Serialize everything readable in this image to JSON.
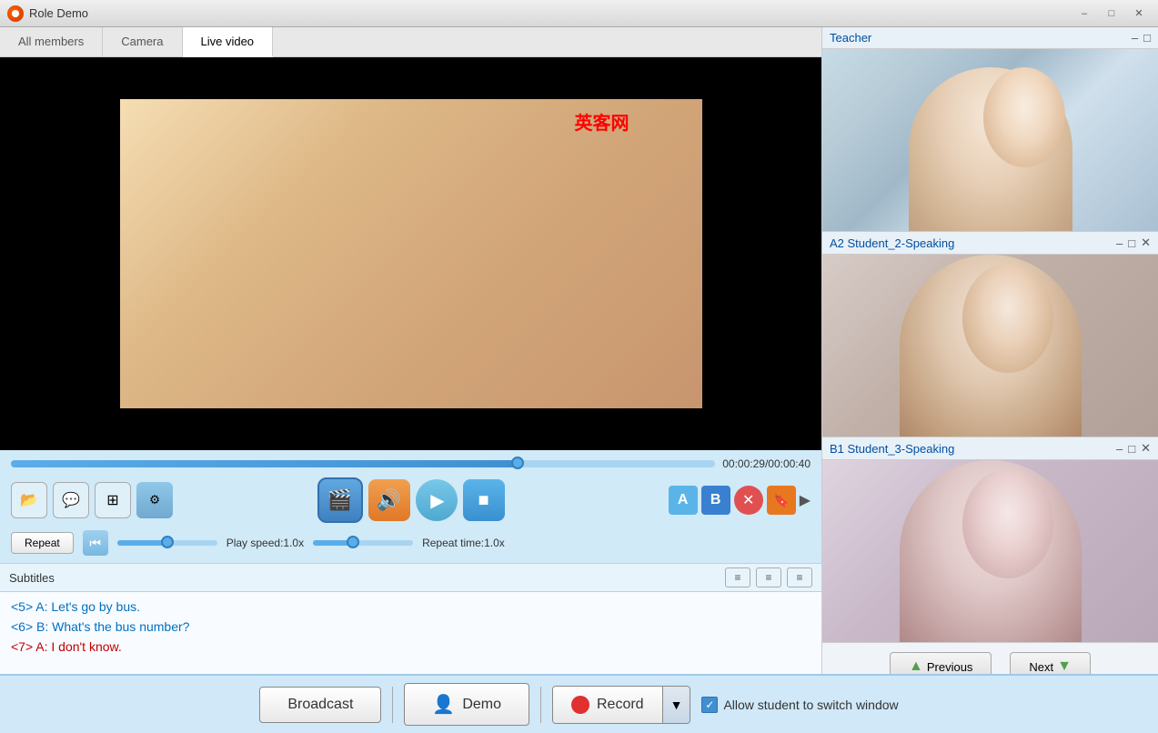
{
  "titlebar": {
    "title": "Role Demo",
    "logo": "role-demo-logo",
    "minimize": "–",
    "maximize": "□",
    "close": "✕"
  },
  "tabs": {
    "items": [
      {
        "id": "all-members",
        "label": "All members",
        "active": false
      },
      {
        "id": "camera",
        "label": "Camera",
        "active": false
      },
      {
        "id": "live-video",
        "label": "Live video",
        "active": true
      }
    ]
  },
  "video": {
    "watermark": "英客网",
    "time_current": "00:00:29",
    "time_total": "00:00:40",
    "time_display": "00:00:29/00:00:40",
    "progress_percent": 72
  },
  "controls": {
    "play_speed_label": "Play speed:1.0x",
    "repeat_time_label": "Repeat time:1.0x",
    "repeat_btn": "Repeat",
    "buttons": {
      "folder": "📁",
      "subtitles": "💬",
      "ab": "AB",
      "gear": "⚙",
      "video_film": "🎬",
      "audio_wave": "🔊",
      "play": "▶",
      "stop": "■",
      "a_btn": "A",
      "b_btn": "B",
      "x_btn": "✕",
      "bookmark": "🔖",
      "more": "▶"
    }
  },
  "subtitles": {
    "title": "Subtitles",
    "lines": [
      {
        "id": "line1",
        "text": "<5> A: Let's go by bus.",
        "color": "blue"
      },
      {
        "id": "line2",
        "text": "<6> B: What's the bus number?",
        "color": "blue"
      },
      {
        "id": "line3",
        "text": "<7> A: I don't know.",
        "color": "red"
      }
    ]
  },
  "right_panel": {
    "teacher": {
      "title": "Teacher",
      "minimize": "–",
      "maximize": "□"
    },
    "student2": {
      "title": "A2 Student_2-Speaking",
      "minimize": "–",
      "maximize": "□",
      "close": "✕"
    },
    "student3": {
      "title": "B1 Student_3-Speaking",
      "minimize": "–",
      "maximize": "□",
      "close": "✕"
    },
    "prev_btn": "Previous",
    "next_btn": "Next"
  },
  "bottom": {
    "broadcast_label": "Broadcast",
    "demo_label": "Demo",
    "record_label": "Record",
    "allow_label": "Allow student to switch window",
    "dropdown_arrow": "▼",
    "record_icon_color": "#e03030"
  }
}
